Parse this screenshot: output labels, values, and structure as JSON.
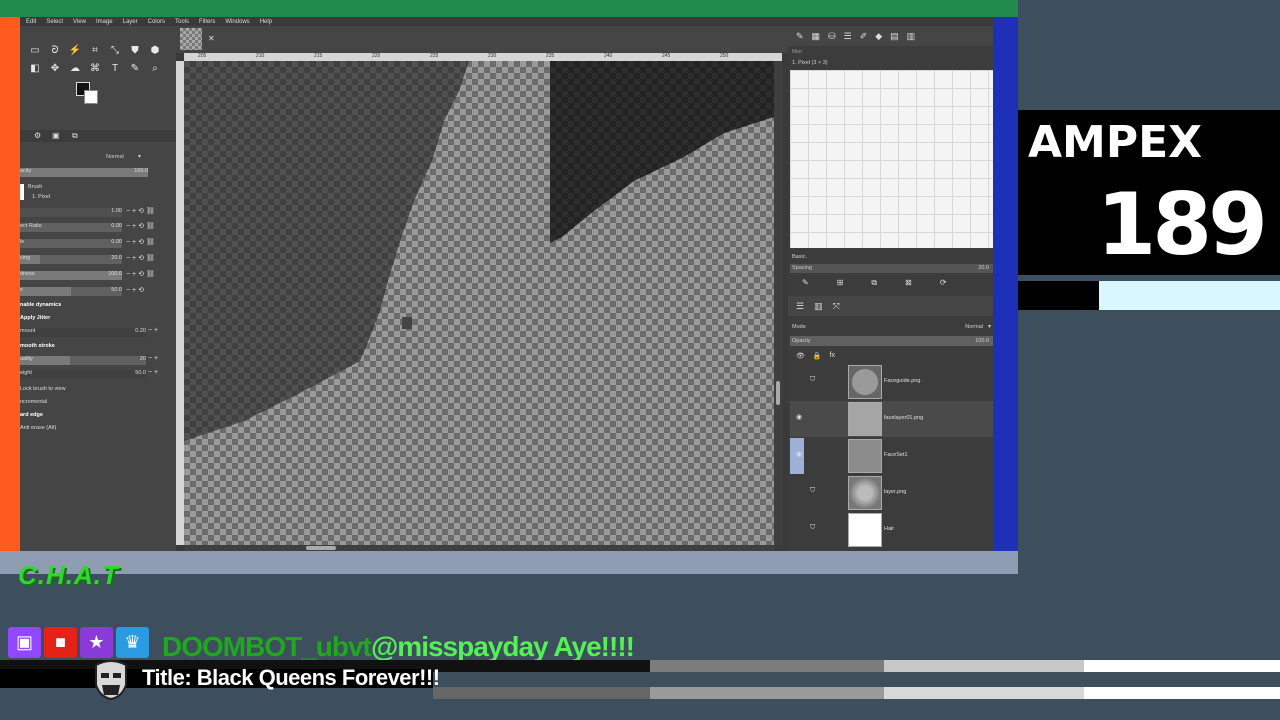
{
  "gimp": {
    "menus": [
      "Edit",
      "Select",
      "View",
      "Image",
      "Layer",
      "Colors",
      "Tools",
      "Filters",
      "Windows",
      "Help"
    ],
    "tool_options": {
      "mode_value": "Normal",
      "opacity_label": "acity",
      "opacity_value": "100.0",
      "brush_label": "Brush",
      "brush_name": "1. Pixel",
      "size_value": "1.00",
      "aspect_label": "ect Ratio",
      "aspect_value": "0.00",
      "angle_label": "le",
      "angle_value": "0.00",
      "spacing_label": "cing",
      "spacing_value": "20.0",
      "hardness_label": "dness",
      "hardness_value": "100.0",
      "force_label": "e",
      "force_value": "50.0",
      "dynamics_label": "nable dynamics",
      "jitter_label": "Apply Jitter",
      "amount_label": "mount",
      "amount_value": "0.20",
      "smooth_label": "mooth stroke",
      "quality_label": "uality",
      "quality_value": "20",
      "weight_label": "eight",
      "weight_value": "50.0",
      "lock_label": "Lock brush to view",
      "incremental_label": "ncremental",
      "hard_edge_label": "ard edge",
      "anti_erase_label": "Anti erase (Alt)"
    },
    "ruler_ticks": [
      "205",
      "210",
      "215",
      "220",
      "225",
      "230",
      "235",
      "240",
      "245",
      "250"
    ],
    "brushes_panel": {
      "filter_placeholder": "filter",
      "brush_title": "1. Pixel (3 × 3)",
      "preset_name": "Basic.",
      "spacing_label": "Spacing",
      "spacing_value": "20.0"
    },
    "layers_panel": {
      "mode_label": "Mode",
      "mode_value": "Normal",
      "opacity_label": "Opacity",
      "opacity_value": "100.0",
      "layers": [
        {
          "name": "Faceguide.png",
          "visible": false,
          "locked": true
        },
        {
          "name": "facelayer01.png",
          "visible": true,
          "locked": false
        },
        {
          "name": "FaceSet1",
          "visible": true,
          "locked": false
        },
        {
          "name": "layer.png",
          "visible": false,
          "locked": true
        },
        {
          "name": "Hair",
          "visible": false,
          "locked": true
        }
      ]
    }
  },
  "overlay": {
    "brand": "AMPEX",
    "number": "189",
    "chat_logo": "C.H.A.T",
    "chat_username": "DOOMBOT_ubvt",
    "chat_message": "@misspayday Aye!!!!",
    "title": "Title: Black Queens Forever!!!"
  },
  "colors": {
    "frame_green": "#1f8a4c",
    "frame_orange": "#ff5a1f",
    "frame_blue": "#1e30b8",
    "chat_green": "#55f055",
    "twitch_purple": "#9146ff",
    "youtube_red": "#e62117"
  }
}
